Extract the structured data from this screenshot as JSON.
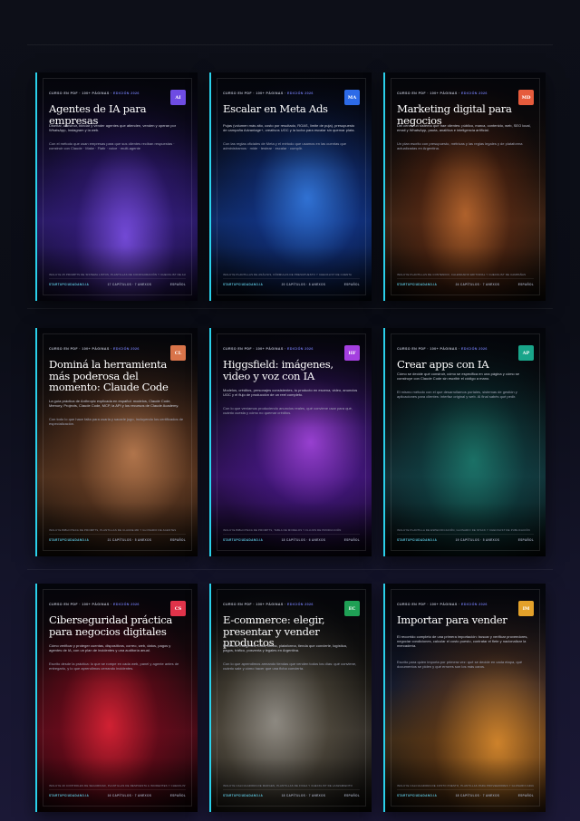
{
  "catalog": {
    "cards": [
      {
        "eyebrow": "CURSO EN PDF · 100+ PÁGINAS · ",
        "edition": "EDICIÓN 2026",
        "badge": "AI",
        "badge_color": "#6e4ce3",
        "title": "Agentes de IA para empresas",
        "desc": "Diseñar, construir, blindar y vender agentes que atienden, venden y operan por WhatsApp, Instagram y la web.",
        "desc2": "Con el método que usan empresas para que sus clientes reciban respuestas · construir con Claude · Make · Flatir · voice · multi-agente",
        "footline": "INCLUYE 25 PROMPTS DE SISTEMA LISTOS, PLANTILLAS DE CONFIGURACIÓN Y CHECKLIST DE AUDITORÍA",
        "site": "STARTUPCIUDADANO.IA",
        "meta": "17 CAPÍTULOS · 7 ANEXOS",
        "lang": "ESPAÑOL"
      },
      {
        "eyebrow": "CURSO EN PDF · 100+ PÁGINAS · ",
        "edition": "EDICIÓN 2026",
        "badge": "MA",
        "badge_color": "#2d6be8",
        "title": "Escalar en Meta Ads",
        "desc": "Pujas (volumen más alto, costo por resultado, ROAS, límite de puja), presupuesto de campaña Advantage+, creativos UGC y la lucha para escalar sin quemar plata.",
        "desc2": "Con las reglas oficiales de Meta y el método que usamos en las cuentas que administramos · mide · testear · escalar · cumplir.",
        "footline": "INCLUYE PLANTILLAS DE ANÁLISIS, FÓRMULAS DE PRESUPUESTO Y CHECKLIST DE CUENTA",
        "site": "STARTUPCIUDADANO.IA",
        "meta": "20 CAPÍTULOS · 8 ANEXOS",
        "lang": "ESPAÑOL"
      },
      {
        "eyebrow": "CURSO EN PDF · 100+ PÁGINAS · ",
        "edition": "EDICIÓN 2026",
        "badge": "MD",
        "badge_color": "#e65b3c",
        "title": "Marketing digital para negocios",
        "desc": "Del cero a un sistema que trae clientes: público, marca, contenido, web, SEO local, email y WhatsApp, pauta, analítica e inteligencia artificial.",
        "desc2": "Un plan escrito con presupuesto, métricas y las reglas legales y de plataforma actualizadas en Argentina.",
        "footline": "INCLUYE PLANTILLAS DE CONTENIDO, CALENDARIO EDITORIAL Y CHECKLIST DE CAMPAÑAS",
        "site": "STARTUPCIUDADANO.IA",
        "meta": "24 CAPÍTULOS · 7 ANEXOS",
        "lang": "ESPAÑOL"
      },
      {
        "eyebrow": "CURSO EN PDF · 100+ PÁGINAS · ",
        "edition": "EDICIÓN 2026",
        "badge": "CL",
        "badge_color": "#d9744a",
        "title": "Dominá la herramienta más poderosa del momento: Claude Code",
        "desc": "La guía práctica de Anthropic explicada en español: modelos, Claude Code, Memory, Projects, Claude Code, MCP, la API y los recursos de Claude Academy.",
        "desc2": "Con todo lo que hace falta para usarla y sacarle jugo, incluyendo los certificados de especialización.",
        "footline": "INCLUYE BIBLIOTECA DE PROMPTS, PLANTILLAS DE CLAUDE.MD Y GLOSARIO DE AGENTES",
        "site": "STARTUPCIUDADANO.IA",
        "meta": "21 CAPÍTULOS · 5 ANEXOS",
        "lang": "ESPAÑOL"
      },
      {
        "eyebrow": "CURSO EN PDF · 100+ PÁGINAS · ",
        "edition": "EDICIÓN 2026",
        "badge": "HF",
        "badge_color": "#a43fe0",
        "title": "Higgsfield: imágenes, video y voz con IA",
        "desc": "Modelos, créditos, personajes consistentes, tu producto en escena, video, anuncios UGC y el flujo de producción de un reel completo.",
        "desc2": "Con lo que veníamos produciendo anuncios reales, qué conviene usar para qué, cuánto cuesta y cómo no quemar créditos.",
        "footline": "INCLUYE BIBLIOTECA DE PROMPTS, TABLA DE MODELOS Y FLUJOS DE PRODUCCIÓN",
        "site": "STARTUPCIUDADANO.IA",
        "meta": "18 CAPÍTULOS · 6 ANEXOS",
        "lang": "ESPAÑOL"
      },
      {
        "eyebrow": "CURSO EN PDF · 100+ PÁGINAS · ",
        "edition": "EDICIÓN 2026",
        "badge": "AP",
        "badge_color": "#19a58a",
        "title": "Crear apps con IA",
        "desc": "Cómo se decide qué construir, cómo se especifica en una página y cómo se construye con Claude Code sin escribir el código a mano.",
        "desc2": "El mismo método con el que desarrollamos portales, sistemas de gestión y aplicaciones para clientes: interfaz original y web. Al final sabés qué pedir.",
        "footline": "INCLUYE PLANTILLA DE ESPECIFICACIÓN, GLOSARIO DE STACK Y CHECKLIST DE PUBLICACIÓN",
        "site": "STARTUPCIUDADANO.IA",
        "meta": "19 CAPÍTULOS · 5 ANEXOS",
        "lang": "ESPAÑOL"
      },
      {
        "eyebrow": "CURSO EN PDF · 100+ PÁGINAS · ",
        "edition": "EDICIÓN 2026",
        "badge": "CS",
        "badge_color": "#e0334a",
        "title": "Ciberseguridad práctica para negocios digitales",
        "desc": "Cómo verificar y proteger cuentas, dispositivos, correo, web, datos, pagos y agentes de IA, con un plan de incidentes y una auditoría anual.",
        "desc2": "Escrito desde la práctica: lo que se rompe en cada web, panel y agente antes de entregarlo, y lo que aprendimos cerrando incidentes.",
        "footline": "INCLUYE 40 CONTROLES DE SEGURIDAD, PLANTILLAS DE RESPUESTA A INCIDENTES Y CHECKLIST DE AUDITORÍA",
        "site": "STARTUPCIUDADANO.IA",
        "meta": "16 CAPÍTULOS · 7 ANEXOS",
        "lang": "ESPAÑOL"
      },
      {
        "eyebrow": "CURSO EN PDF · 100+ PÁGINAS · ",
        "edition": "EDICIÓN 2026",
        "badge": "EC",
        "badge_color": "#1fa055",
        "title": "E-commerce: elegir, presentar y vender productos",
        "desc": "Producto, márgenes, fotos, fichas, plataforma, tienda que convierte, logística, pagos, tráfico, posventa y legales en Argentina.",
        "desc2": "Con lo que aprendimos armando tiendas que venden todos los días: qué conviene, cuánto sale y cómo hacer que una ficha convierta.",
        "footline": "INCLUYE CALCULADORA DE MARGEN, PLANTILLAS DE FICHA Y CHECKLIST DE LANZAMIENTO",
        "site": "STARTUPCIUDADANO.IA",
        "meta": "18 CAPÍTULOS · 7 ANEXOS",
        "lang": "ESPAÑOL"
      },
      {
        "eyebrow": "CURSO EN PDF · 100+ PÁGINAS · ",
        "edition": "EDICIÓN 2026",
        "badge": "IM",
        "badge_color": "#e3a12a",
        "title": "Importar para vender",
        "desc": "El recorrido completo de una primera importación: buscar y verificar proveedores, negociar condiciones, calcular el costo puesto, contratar el flete y nacionalizar la mercadería.",
        "desc2": "Escrito para quien importa por primera vez: qué se decide en cada etapa, qué documentos se piden y qué errores son los más caros.",
        "footline": "INCLUYE CALCULADORA DE COSTO PUESTO, PLANTILLAS PARA PROVEEDORES Y GLOSARIO ADUANERO",
        "site": "STARTUPCIUDADANO.IA",
        "meta": "18 CAPÍTULOS · 7 ANEXOS",
        "lang": "ESPAÑOL"
      }
    ]
  }
}
